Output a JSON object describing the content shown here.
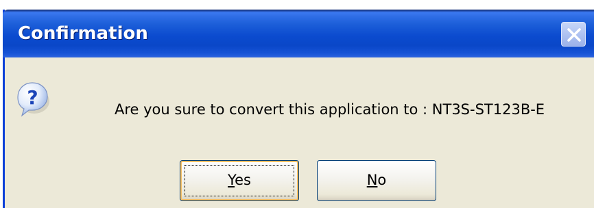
{
  "window": {
    "title": "Confirmation",
    "close_icon": "close-icon"
  },
  "dialog": {
    "icon": "question-icon",
    "message": "Are you sure to convert this application to : NT3S-ST123B-E"
  },
  "buttons": {
    "yes": {
      "accel": "Y",
      "rest": "es"
    },
    "no": {
      "accel": "N",
      "rest": "o"
    }
  },
  "colors": {
    "titlebar": "#0a4bcf",
    "dialog_bg": "#ece9d8",
    "button_border": "#003c74",
    "focus_ring": "#f9c164"
  }
}
